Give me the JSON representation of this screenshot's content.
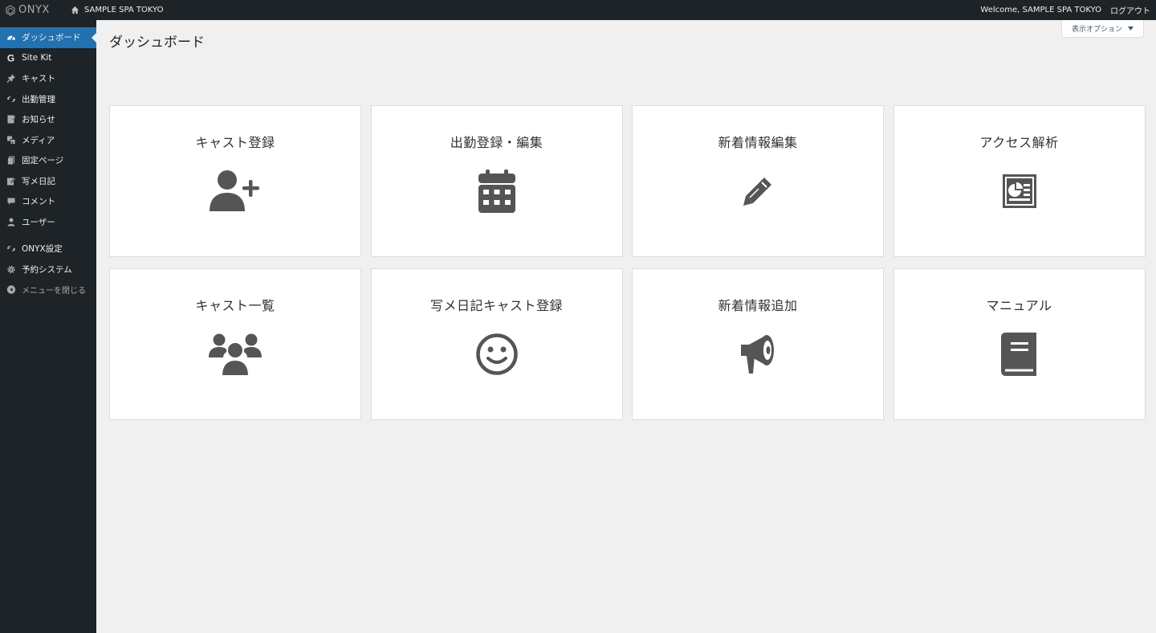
{
  "adminbar": {
    "logo_text": "ONYX",
    "site_name": "SAMPLE SPA TOKYO",
    "welcome": "Welcome, SAMPLE SPA TOKYO",
    "logout": "ログアウト"
  },
  "sidebar": {
    "items": [
      {
        "label": "ダッシュボード",
        "icon": "dashboard-icon",
        "active": true
      },
      {
        "label": "Site Kit",
        "icon": "google-g-icon"
      },
      {
        "label": "キャスト",
        "icon": "pin-icon"
      },
      {
        "label": "出勤管理",
        "icon": "onyx-swirl-icon"
      },
      {
        "label": "お知らせ",
        "icon": "document-edit-icon"
      },
      {
        "label": "メディア",
        "icon": "media-icon"
      },
      {
        "label": "固定ページ",
        "icon": "pages-icon"
      },
      {
        "label": "写メ日記",
        "icon": "note-edit-icon"
      },
      {
        "label": "コメント",
        "icon": "comment-icon"
      },
      {
        "label": "ユーザー",
        "icon": "user-icon"
      },
      {
        "label": "ONYX設定",
        "icon": "onyx-swirl-icon"
      },
      {
        "label": "予約システム",
        "icon": "gear-icon"
      },
      {
        "label": "メニューを閉じる",
        "icon": "collapse-icon"
      }
    ]
  },
  "main": {
    "title": "ダッシュボード",
    "screen_options": "表示オプション",
    "cards": [
      {
        "label": "キャスト登録",
        "icon": "user-plus-icon"
      },
      {
        "label": "出勤登録・編集",
        "icon": "calendar-icon"
      },
      {
        "label": "新着情報編集",
        "icon": "pencil-icon"
      },
      {
        "label": "アクセス解析",
        "icon": "analytics-icon"
      },
      {
        "label": "キャスト一覧",
        "icon": "users-group-icon"
      },
      {
        "label": "写メ日記キャスト登録",
        "icon": "smile-icon"
      },
      {
        "label": "新着情報追加",
        "icon": "megaphone-icon"
      },
      {
        "label": "マニュアル",
        "icon": "book-icon"
      }
    ]
  },
  "colors": {
    "adminbar_bg": "#1d2327",
    "sidebar_bg": "#1d2327",
    "active_bg": "#2271b1",
    "content_bg": "#f0f0f1",
    "icon_color": "#555555"
  }
}
